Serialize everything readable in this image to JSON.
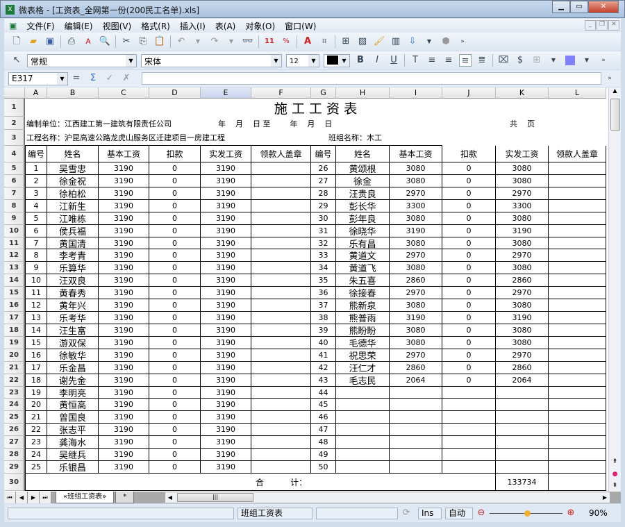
{
  "window": {
    "title": "微表格 - [工资表_全网第一份(200民工名单).xls]",
    "app_icon": "X"
  },
  "menu": [
    "文件(F)",
    "编辑(E)",
    "视图(V)",
    "格式(R)",
    "插入(I)",
    "表(A)",
    "对象(O)",
    "窗口(W)"
  ],
  "format": {
    "number_format": "常规",
    "font": "宋体",
    "font_size": "12"
  },
  "formula_bar": {
    "cell_ref": "E317",
    "value": ""
  },
  "columns": [
    "A",
    "B",
    "C",
    "D",
    "E",
    "F",
    "G",
    "H",
    "I",
    "J",
    "K",
    "L"
  ],
  "selected_column": "E",
  "sheet": {
    "title": "施 工 工 资 表",
    "row2_left": "编制单位：江西建工第一建筑有限责任公司",
    "row2_date": "年    月    日 至        年    月    日",
    "row2_pages": "共    页",
    "row3_project": "工程名称：沪昆高速公路龙虎山服务区迁建项目一房建工程",
    "row3_team": "班组名称：木工",
    "headers": [
      "编号",
      "姓名",
      "基本工资",
      "扣款",
      "实发工资",
      "领款人盖章"
    ],
    "left": [
      [
        "1",
        "吴雪忠",
        "3190",
        "0",
        "3190"
      ],
      [
        "2",
        "徐金祝",
        "3190",
        "0",
        "3190"
      ],
      [
        "3",
        "徐柏松",
        "3190",
        "0",
        "3190"
      ],
      [
        "4",
        "江新生",
        "3190",
        "0",
        "3190"
      ],
      [
        "5",
        "江唯栋",
        "3190",
        "0",
        "3190"
      ],
      [
        "6",
        "侯兵福",
        "3190",
        "0",
        "3190"
      ],
      [
        "7",
        "黄国清",
        "3190",
        "0",
        "3190"
      ],
      [
        "8",
        "李考青",
        "3190",
        "0",
        "3190"
      ],
      [
        "9",
        "乐算华",
        "3190",
        "0",
        "3190"
      ],
      [
        "10",
        "汪双良",
        "3190",
        "0",
        "3190"
      ],
      [
        "11",
        "黄春秀",
        "3190",
        "0",
        "3190"
      ],
      [
        "12",
        "黄年兴",
        "3190",
        "0",
        "3190"
      ],
      [
        "13",
        "乐考华",
        "3190",
        "0",
        "3190"
      ],
      [
        "14",
        "汪生富",
        "3190",
        "0",
        "3190"
      ],
      [
        "15",
        "游双保",
        "3190",
        "0",
        "3190"
      ],
      [
        "16",
        "徐敏华",
        "3190",
        "0",
        "3190"
      ],
      [
        "17",
        "乐金昌",
        "3190",
        "0",
        "3190"
      ],
      [
        "18",
        "谢先金",
        "3190",
        "0",
        "3190"
      ],
      [
        "19",
        "李明亮",
        "3190",
        "0",
        "3190"
      ],
      [
        "20",
        "黄恒高",
        "3190",
        "0",
        "3190"
      ],
      [
        "21",
        "曾国良",
        "3190",
        "0",
        "3190"
      ],
      [
        "22",
        "张志平",
        "3190",
        "0",
        "3190"
      ],
      [
        "23",
        "龚海水",
        "3190",
        "0",
        "3190"
      ],
      [
        "24",
        "吴继兵",
        "3190",
        "0",
        "3190"
      ],
      [
        "25",
        "乐银昌",
        "3190",
        "0",
        "3190"
      ]
    ],
    "right": [
      [
        "26",
        "黄颂根",
        "3080",
        "0",
        "3080"
      ],
      [
        "27",
        "徐金",
        "3080",
        "0",
        "3080"
      ],
      [
        "28",
        "汪贵良",
        "2970",
        "0",
        "2970"
      ],
      [
        "29",
        "彭长华",
        "3300",
        "0",
        "3300"
      ],
      [
        "30",
        "彭年良",
        "3080",
        "0",
        "3080"
      ],
      [
        "31",
        "徐晓华",
        "3190",
        "0",
        "3190"
      ],
      [
        "32",
        "乐有昌",
        "3080",
        "0",
        "3080"
      ],
      [
        "33",
        "黄道文",
        "2970",
        "0",
        "2970"
      ],
      [
        "34",
        "黄道飞",
        "3080",
        "0",
        "3080"
      ],
      [
        "35",
        "朱五喜",
        "2860",
        "0",
        "2860"
      ],
      [
        "36",
        "徐接春",
        "2970",
        "0",
        "2970"
      ],
      [
        "37",
        "熊新泉",
        "3080",
        "0",
        "3080"
      ],
      [
        "38",
        "熊普雨",
        "3190",
        "0",
        "3190"
      ],
      [
        "39",
        "熊盼盼",
        "3080",
        "0",
        "3080"
      ],
      [
        "40",
        "毛德华",
        "3080",
        "0",
        "3080"
      ],
      [
        "41",
        "祝思荣",
        "2970",
        "0",
        "2970"
      ],
      [
        "42",
        "汪仁才",
        "2860",
        "0",
        "2860"
      ],
      [
        "43",
        "毛志民",
        "2064",
        "0",
        "2064"
      ],
      [
        "44",
        "",
        "",
        "",
        ""
      ],
      [
        "45",
        "",
        "",
        "",
        ""
      ],
      [
        "46",
        "",
        "",
        "",
        ""
      ],
      [
        "47",
        "",
        "",
        "",
        ""
      ],
      [
        "48",
        "",
        "",
        "",
        ""
      ],
      [
        "49",
        "",
        "",
        "",
        ""
      ],
      [
        "50",
        "",
        "",
        "",
        ""
      ]
    ],
    "total_label": "合          计：",
    "total": "133734"
  },
  "tabs": {
    "active": "«班组工资表»",
    "new": "*"
  },
  "status": {
    "sheet_name": "班组工资表",
    "mode": "Ins",
    "calc": "自动",
    "zoom": "90%",
    "zoom_fraction": 0.5
  }
}
